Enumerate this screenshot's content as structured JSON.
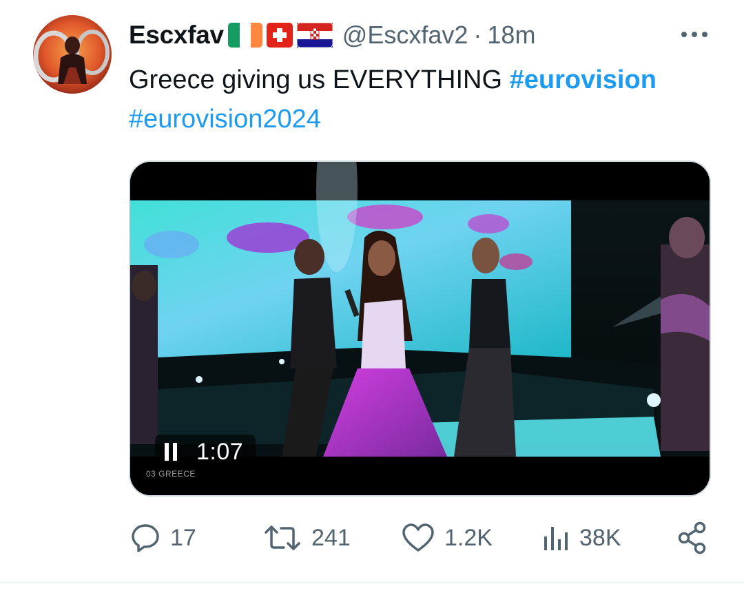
{
  "tweet": {
    "display_name": "Escxfav",
    "flags": [
      "ireland-flag",
      "switzerland-flag",
      "croatia-flag"
    ],
    "handle": "@Escxfav2",
    "separator": "·",
    "time": "18m",
    "text": "Greece giving us EVERYTHING ",
    "hashtags": [
      "#eurovision",
      "#eurovision2024"
    ]
  },
  "media": {
    "state": "playing",
    "time_label": "1:07",
    "caption": "03 GREECE"
  },
  "actions": {
    "replies": "17",
    "retweets": "241",
    "likes": "1.2K",
    "views": "38K"
  },
  "colors": {
    "hashtag": "#1d9bf0",
    "muted": "#536471",
    "text": "#0f1419",
    "border": "#cfd9de"
  },
  "icons": [
    "more-icon",
    "reply-icon",
    "retweet-icon",
    "like-icon",
    "views-icon",
    "share-icon",
    "pause-icon"
  ]
}
